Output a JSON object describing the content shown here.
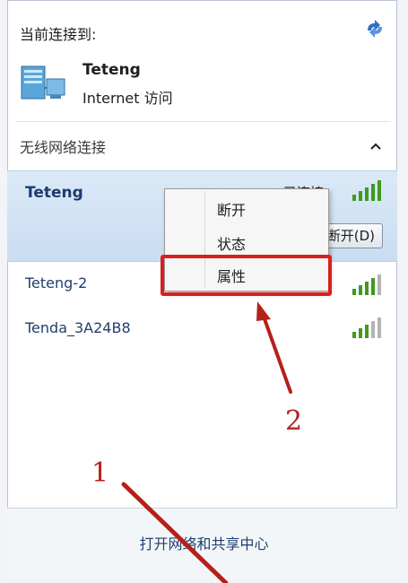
{
  "header": {
    "title": "当前连接到:",
    "refresh_icon": "refresh-icon"
  },
  "current_connection": {
    "name": "Teteng",
    "access": "Internet 访问",
    "icon": "computer-network-icon"
  },
  "wireless_section": {
    "title": "无线网络连接",
    "collapse_icon": "chevron-up-icon"
  },
  "networks": [
    {
      "name": "Teteng",
      "status": "已连接",
      "button_label": "断开(D)",
      "signal_bars": 5,
      "selected": true
    },
    {
      "name": "Teteng-2",
      "signal_bars": 4,
      "selected": false
    },
    {
      "name": "Tenda_3A24B8",
      "signal_bars": 3,
      "selected": false
    }
  ],
  "context_menu": {
    "items": [
      "断开",
      "状态",
      "属性"
    ],
    "highlighted": "属性"
  },
  "footer": {
    "link": "打开网络和共享中心"
  },
  "annotations": {
    "one": "1",
    "two": "2"
  },
  "colors": {
    "signal_active": "#3f9b1e",
    "signal_inactive": "#b3b3b3",
    "annotation": "#b5201a",
    "selected_bg": "#d3e4f5"
  }
}
